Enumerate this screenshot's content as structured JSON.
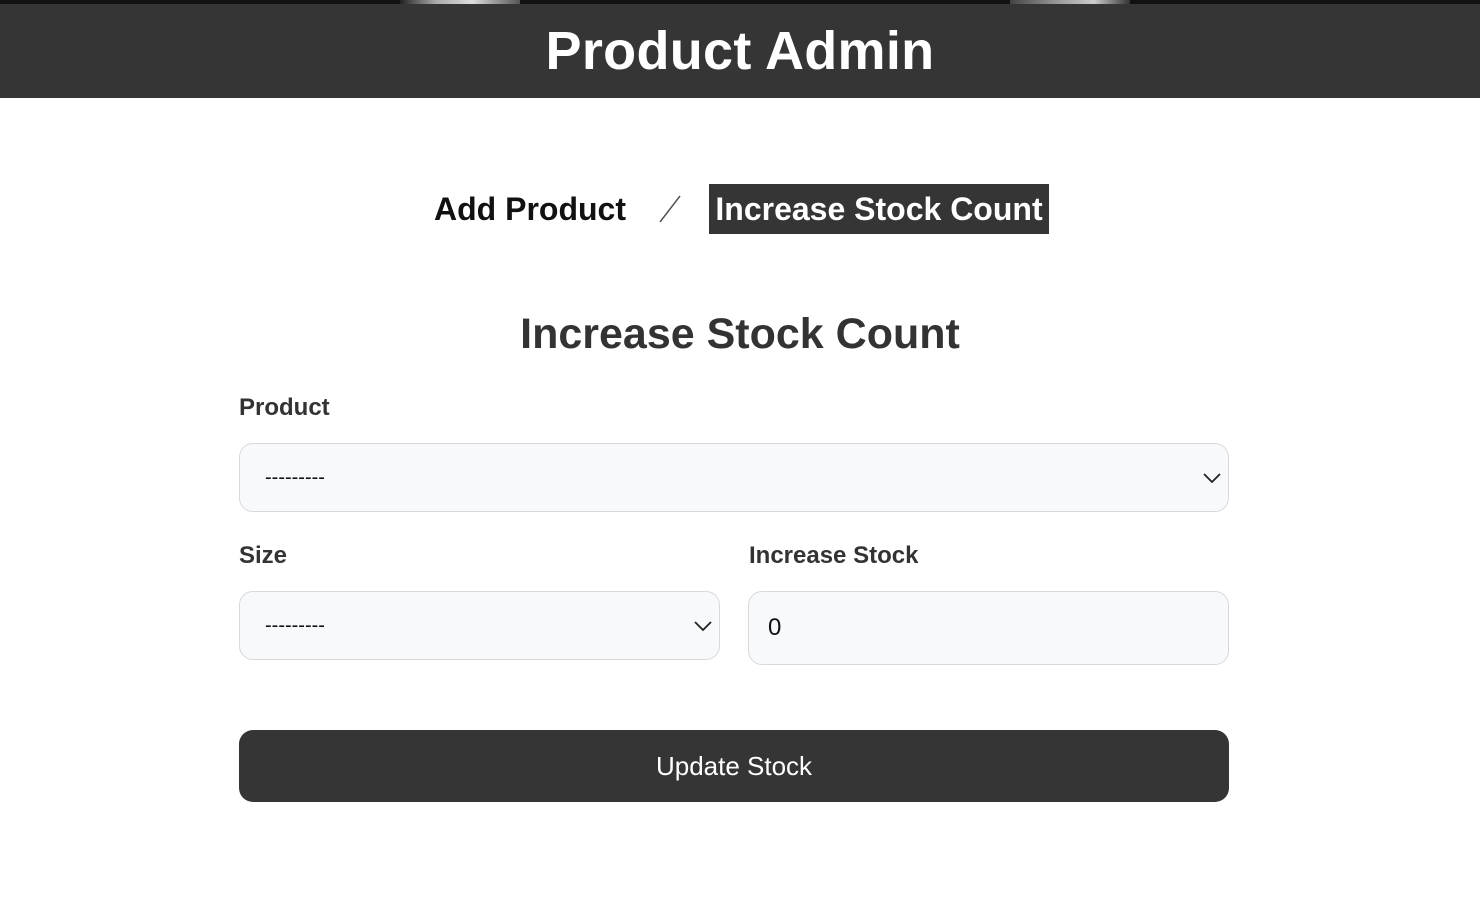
{
  "header": {
    "title": "Product Admin"
  },
  "tabs": [
    {
      "label": "Add Product",
      "active": false
    },
    {
      "label": "Increase Stock Count",
      "active": true
    }
  ],
  "tab_separator": "/",
  "form": {
    "title": "Increase Stock Count",
    "product": {
      "label": "Product",
      "selected": "---------"
    },
    "size": {
      "label": "Size",
      "selected": "---------"
    },
    "increase_stock": {
      "label": "Increase Stock",
      "value": "0"
    },
    "submit_label": "Update Stock"
  },
  "colors": {
    "header_bg": "#353535",
    "active_tab_bg": "#353535",
    "button_bg": "#353535",
    "field_bg": "#f7f9fb",
    "field_border": "#d7d9dd",
    "text": "#333333"
  },
  "icons": {
    "dropdown": "chevron-down-icon",
    "separator": "slash-divider"
  }
}
